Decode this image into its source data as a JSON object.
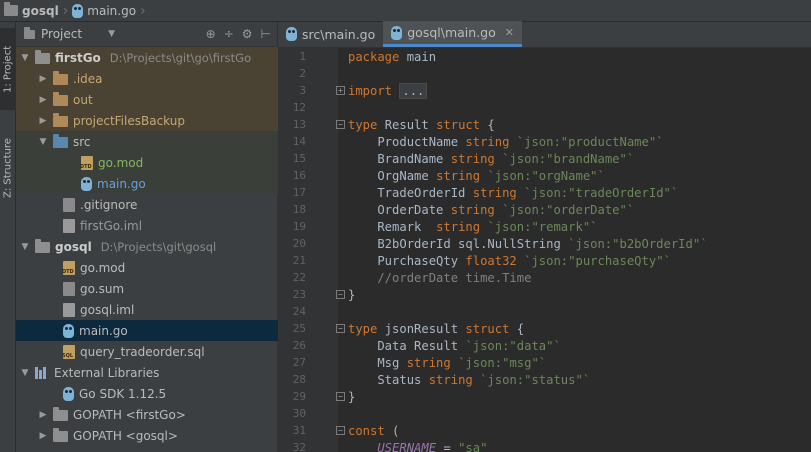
{
  "breadcrumb": {
    "project": "gosql",
    "file": "main.go"
  },
  "stripe": {
    "project_tab": "1: Project",
    "structure_tab": "Z: Structure"
  },
  "panel": {
    "title": "Project"
  },
  "tree": [
    {
      "label": "firstGo",
      "path": "D:\\Projects\\git\\go\\firstGo"
    },
    {
      "label": ".idea"
    },
    {
      "label": "out"
    },
    {
      "label": "projectFilesBackup"
    },
    {
      "label": "src"
    },
    {
      "label": "go.mod"
    },
    {
      "label": "main.go"
    },
    {
      "label": ".gitignore"
    },
    {
      "label": "firstGo.iml"
    },
    {
      "label": "gosql",
      "path": "D:\\Projects\\git\\gosql"
    },
    {
      "label": "go.mod"
    },
    {
      "label": "go.sum"
    },
    {
      "label": "gosql.iml"
    },
    {
      "label": "main.go"
    },
    {
      "label": "query_tradeorder.sql"
    },
    {
      "label": "External Libraries"
    },
    {
      "label": "Go SDK 1.12.5"
    },
    {
      "label": "GOPATH <firstGo>"
    },
    {
      "label": "GOPATH <gosql>"
    }
  ],
  "tabs": [
    {
      "label": "src\\main.go"
    },
    {
      "label": "gosql\\main.go"
    }
  ],
  "code": [
    {
      "n": "1",
      "t": [
        [
          "kw",
          "package"
        ],
        [
          "txt",
          " main"
        ]
      ]
    },
    {
      "n": "2",
      "t": []
    },
    {
      "n": "3",
      "fold": "+",
      "t": [
        [
          "kw",
          "import"
        ],
        [
          "txt",
          " "
        ],
        [
          "box",
          "..."
        ]
      ]
    },
    {
      "n": "12",
      "t": []
    },
    {
      "n": "13",
      "fold": "-",
      "t": [
        [
          "kw",
          "type"
        ],
        [
          "txt",
          " Result "
        ],
        [
          "kw",
          "struct"
        ],
        [
          "txt",
          " {"
        ]
      ]
    },
    {
      "n": "14",
      "t": [
        [
          "txt",
          "    ProductName "
        ],
        [
          "ty",
          "string"
        ],
        [
          "txt",
          " "
        ],
        [
          "tag",
          "`json:\"productName\"`"
        ]
      ]
    },
    {
      "n": "15",
      "t": [
        [
          "txt",
          "    BrandName "
        ],
        [
          "ty",
          "string"
        ],
        [
          "txt",
          " "
        ],
        [
          "tag",
          "`json:\"brandName\"`"
        ]
      ]
    },
    {
      "n": "16",
      "t": [
        [
          "txt",
          "    OrgName "
        ],
        [
          "ty",
          "string"
        ],
        [
          "txt",
          " "
        ],
        [
          "tag",
          "`json:\"orgName\"`"
        ]
      ]
    },
    {
      "n": "17",
      "t": [
        [
          "txt",
          "    TradeOrderId "
        ],
        [
          "ty",
          "string"
        ],
        [
          "txt",
          " "
        ],
        [
          "tag",
          "`json:\"tradeOrderId\"`"
        ]
      ]
    },
    {
      "n": "18",
      "t": [
        [
          "txt",
          "    OrderDate "
        ],
        [
          "ty",
          "string"
        ],
        [
          "txt",
          " "
        ],
        [
          "tag",
          "`json:\"orderDate\"`"
        ]
      ]
    },
    {
      "n": "19",
      "t": [
        [
          "txt",
          "    Remark  "
        ],
        [
          "ty",
          "string"
        ],
        [
          "txt",
          " "
        ],
        [
          "tag",
          "`json:\"remark\"`"
        ]
      ]
    },
    {
      "n": "20",
      "t": [
        [
          "txt",
          "    B2bOrderId sql.NullString "
        ],
        [
          "tag",
          "`json:\"b2bOrderId\"`"
        ]
      ]
    },
    {
      "n": "21",
      "t": [
        [
          "txt",
          "    PurchaseQty "
        ],
        [
          "ty",
          "float32"
        ],
        [
          "txt",
          " "
        ],
        [
          "tag",
          "`json:\"purchaseQty\"`"
        ]
      ]
    },
    {
      "n": "22",
      "t": [
        [
          "cm",
          "    //orderDate time.Time"
        ]
      ]
    },
    {
      "n": "23",
      "fold": "-",
      "t": [
        [
          "txt",
          "}"
        ]
      ]
    },
    {
      "n": "24",
      "t": []
    },
    {
      "n": "25",
      "fold": "-",
      "t": [
        [
          "kw",
          "type"
        ],
        [
          "txt",
          " jsonResult "
        ],
        [
          "kw",
          "struct"
        ],
        [
          "txt",
          " {"
        ]
      ]
    },
    {
      "n": "26",
      "t": [
        [
          "txt",
          "    Data Result "
        ],
        [
          "tag",
          "`json:\"data\"`"
        ]
      ]
    },
    {
      "n": "27",
      "t": [
        [
          "txt",
          "    Msg "
        ],
        [
          "ty",
          "string"
        ],
        [
          "txt",
          " "
        ],
        [
          "tag",
          "`json:\"msg\"`"
        ]
      ]
    },
    {
      "n": "28",
      "t": [
        [
          "txt",
          "    Status "
        ],
        [
          "ty",
          "string"
        ],
        [
          "txt",
          " "
        ],
        [
          "tag",
          "`json:\"status\"`"
        ]
      ]
    },
    {
      "n": "29",
      "fold": "-",
      "t": [
        [
          "txt",
          "}"
        ]
      ]
    },
    {
      "n": "30",
      "t": []
    },
    {
      "n": "31",
      "fold": "-",
      "t": [
        [
          "kw",
          "const"
        ],
        [
          "txt",
          " ("
        ]
      ]
    },
    {
      "n": "32",
      "t": [
        [
          "cn",
          "    USERNAME"
        ],
        [
          "txt",
          " = "
        ],
        [
          "tag",
          "\"sa\""
        ]
      ]
    }
  ]
}
